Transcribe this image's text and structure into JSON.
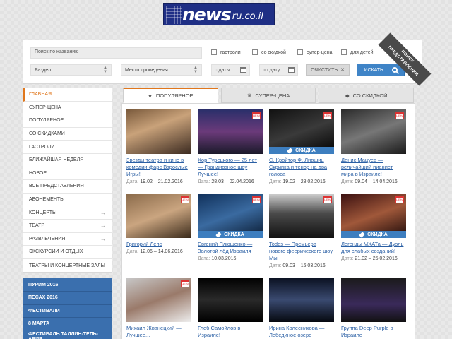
{
  "logo": {
    "main": "news",
    "sub": "ru.co.il"
  },
  "search": {
    "placeholder": "Поиск по названию",
    "checkboxes": [
      "гастроли",
      "со скидкой",
      "супер-цена",
      "для детей"
    ],
    "section_label": "Раздел",
    "venue_label": "Место проведения",
    "date_from": "с даты",
    "date_to": "по дату",
    "clear_label": "ОЧИСТИТЬ",
    "search_label": "ИСКАТЬ",
    "ribbon_label": "ПОИСК ПРЕДСТАВЛЕНИЯ"
  },
  "sidebar": {
    "items": [
      {
        "label": "ГЛАВНАЯ",
        "active": true
      },
      {
        "label": "СУПЕР-ЦЕНА"
      },
      {
        "label": "ПОПУЛЯРНОЕ"
      },
      {
        "label": "СО СКИДКАМИ"
      },
      {
        "label": "ГАСТРОЛИ"
      },
      {
        "label": "БЛИЖАЙШАЯ НЕДЕЛЯ"
      },
      {
        "label": "НОВОЕ"
      },
      {
        "label": "ВСЕ ПРЕДСТАВЛЕНИЯ"
      },
      {
        "label": "АБОНЕМЕНТЫ"
      },
      {
        "label": "КОНЦЕРТЫ",
        "chevron": "→"
      },
      {
        "label": "ТЕАТР",
        "chevron": "→"
      },
      {
        "label": "РАЗВЛЕЧЕНИЯ",
        "chevron": "→"
      },
      {
        "label": "ЭКСКУРСИИ И ОТДЫХ"
      },
      {
        "label": "ТЕАТРЫ И КОНЦЕРТНЫЕ ЗАЛЫ"
      }
    ],
    "special": [
      "ПУРИМ 2016",
      "ПЕСАХ 2016",
      "ФЕСТИВАЛИ",
      "8 МАРТА",
      "ФЕСТИВАЛЬ ТАЛЛИН-ТЕЛЬ-АВИВ"
    ]
  },
  "tabs": [
    {
      "label": "ПОПУЛЯРНОЕ",
      "icon": "star-icon"
    },
    {
      "label": "СУПЕР-ЦЕНА",
      "icon": "gift-icon"
    },
    {
      "label": "СО СКИДКОЙ",
      "icon": "tag-icon"
    }
  ],
  "date_prefix": "Дата:",
  "badge_text": "ЦЕНА",
  "sale_text": "СКИДКА",
  "cards": [
    {
      "title": "Звезды театра и кино в комедии-фарс Взрослые Игры!",
      "date": "19.02 – 21.02.2016",
      "badge": false,
      "sale": false,
      "bg": "linear-gradient(160deg,#7a5a3c,#c9a27a 40%,#3b2a20)"
    },
    {
      "title": "Хор Турецкого — 25 лет — Грандиозное шоу Лучшее!",
      "date": "28.03 – 02.04.2016",
      "badge": true,
      "sale": false,
      "bg": "linear-gradient(180deg,#2a2f6a,#6b3a7a 50%,#1a1a2a)"
    },
    {
      "title": "С. Кройтор Ф. Лившиц Скрипка и тенор на два голоса",
      "date": "19.02 – 28.02.2016",
      "badge": true,
      "sale": true,
      "bg": "linear-gradient(160deg,#111,#3a3a3a 50%,#000)"
    },
    {
      "title": "Денис Мацуев — величайший пианист мира в Израиле!",
      "date": "09.04 – 14.04.2016",
      "badge": true,
      "sale": false,
      "bg": "linear-gradient(160deg,#2b2b2b,#777 50%,#1a1a1a)"
    },
    {
      "title": "Григорий Лепс",
      "date": "12.06 – 14.06.2016",
      "badge": true,
      "sale": false,
      "bg": "linear-gradient(160deg,#8a6a4a,#caa580 50%,#3a2a1a)"
    },
    {
      "title": "Евгений Плющенко — Золотой лёд Израиля",
      "date": "10.03.2016",
      "badge": true,
      "sale": true,
      "bg": "linear-gradient(160deg,#10305a,#3a6aa0 50%,#0a1a30)"
    },
    {
      "title": "Todes — Премьера нового феерического шоу Мы",
      "date": "09.03 – 16.03.2016",
      "badge": true,
      "sale": false,
      "bg": "linear-gradient(180deg,#d0d0d0,#4a4a4a 45%,#111)"
    },
    {
      "title": "Легенды МХАТа — Дуэль для слабых созданий!",
      "date": "21.02 – 25.02.2016",
      "badge": true,
      "sale": true,
      "bg": "linear-gradient(160deg,#3a1010,#a0583a 50%,#1a0808)"
    },
    {
      "title": "Михаил Жванецкий — Лучшее...",
      "date": "",
      "badge": true,
      "sale": false,
      "bg": "linear-gradient(160deg,#c8c8c8,#9a7a6a 50%,#eee)"
    },
    {
      "title": "Глеб Самойлов в Израиле!",
      "date": "",
      "badge": false,
      "sale": false,
      "bg": "linear-gradient(180deg,#000,#2a2a2a 50%,#000)"
    },
    {
      "title": "Ирина Колесникова — Лебединое озеро",
      "date": "",
      "badge": false,
      "sale": false,
      "bg": "linear-gradient(180deg,#0a1020,#3a4a70 50%,#05080f)"
    },
    {
      "title": "Группа Deep Purple в Израиле",
      "date": "",
      "badge": false,
      "sale": false,
      "bg": "linear-gradient(180deg,#1a1a1a,#3a2a5a 60%,#111)"
    }
  ]
}
